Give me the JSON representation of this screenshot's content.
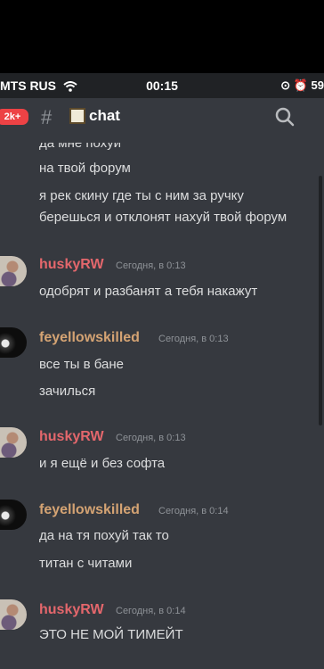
{
  "status_bar": {
    "carrier": "MTS RUS",
    "time": "00:15",
    "battery": "59"
  },
  "header": {
    "badge": "2k+",
    "hash": "#",
    "channel_name": "chat"
  },
  "messages": [
    {
      "text": "да мне похуй"
    },
    {
      "text": "на твой форум"
    },
    {
      "text": "я рек скину где ты с ним за ручку"
    },
    {
      "text": "берешься и отклонят нахуй твой форум"
    },
    {
      "author": "huskyRW",
      "timestamp": "Сегодня, в 0:13",
      "text": "одобрят и разбанят а тебя накажут"
    },
    {
      "author": "feyellowskilled",
      "timestamp": "Сегодня, в 0:13",
      "text": "все ты в бане"
    },
    {
      "text": "зачилься"
    },
    {
      "author": "huskyRW",
      "timestamp": "Сегодня, в 0:13",
      "text": "и я ещё и без софта"
    },
    {
      "author": "feyellowskilled",
      "timestamp": "Сегодня, в 0:14",
      "text": "да на тя похуй так то"
    },
    {
      "text": "титан с читами"
    },
    {
      "author": "huskyRW",
      "timestamp": "Сегодня, в 0:14",
      "text": "ЭТО НЕ МОЙ ТИМЕЙТ"
    }
  ],
  "colors": {
    "background": "#36393f",
    "husky_name": "#e4676c",
    "fey_name": "#d4a373",
    "badge": "#ed4245"
  }
}
